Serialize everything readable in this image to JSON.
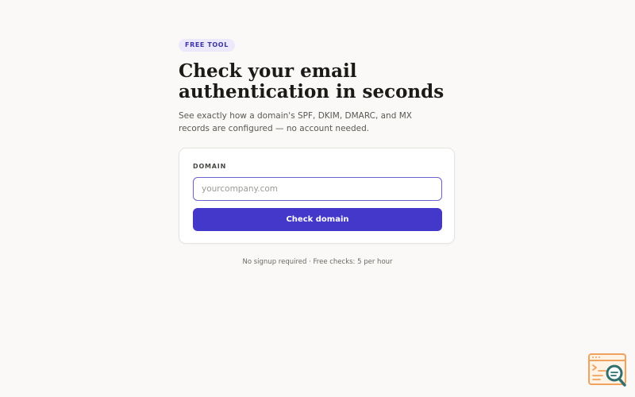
{
  "badge": {
    "label": "FREE TOOL"
  },
  "hero": {
    "title_line1": "Check your email",
    "title_line2": "authentication in seconds",
    "subtitle_line1": "See exactly how a domain's SPF, DKIM, DMARC, and MX",
    "subtitle_line2": "records are configured — no account needed."
  },
  "form": {
    "domain_label": "DOMAIN",
    "domain_placeholder": "yourcompany.com",
    "domain_value": "",
    "submit_label": "Check domain"
  },
  "footnote": "No signup required · Free checks: 5 per hour",
  "colors": {
    "accent": "#4338ca",
    "badge_bg": "#ebe9fb",
    "background": "#faf9f7",
    "widget_orange": "#f0a35e",
    "widget_teal": "#2f6f6d"
  },
  "icons": {
    "corner_widget": "browser-search-icon"
  }
}
